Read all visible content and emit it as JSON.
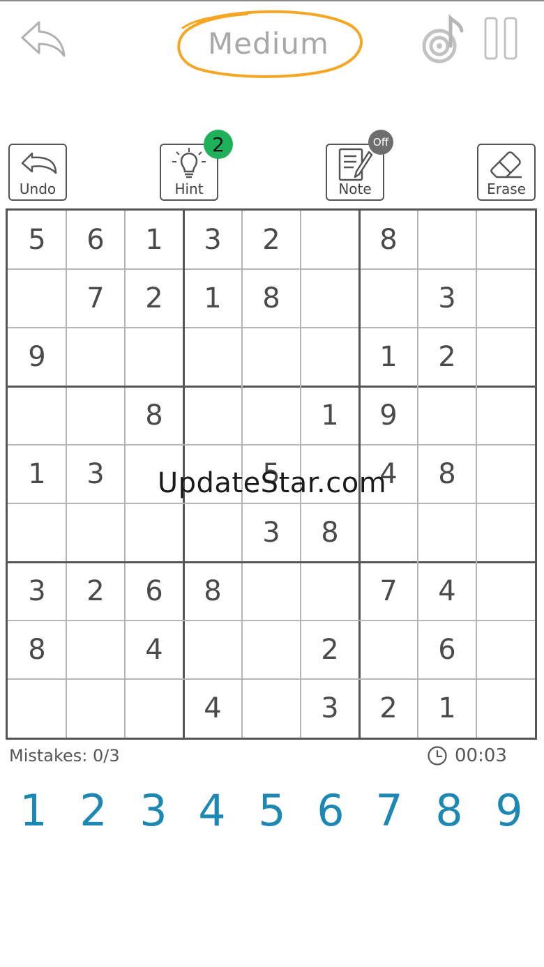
{
  "header": {
    "difficulty": "Medium",
    "accent_color": "#f5a623"
  },
  "tools": {
    "undo_label": "Undo",
    "hint_label": "Hint",
    "hint_count": "2",
    "note_label": "Note",
    "note_state": "Off",
    "erase_label": "Erase"
  },
  "board": {
    "rows": [
      [
        "5",
        "6",
        "1",
        "3",
        "2",
        "",
        "8",
        "",
        ""
      ],
      [
        "",
        "7",
        "2",
        "1",
        "8",
        "",
        "",
        "3",
        ""
      ],
      [
        "9",
        "",
        "",
        "",
        "",
        "",
        "1",
        "2",
        ""
      ],
      [
        "",
        "",
        "8",
        "",
        "",
        "1",
        "9",
        "",
        ""
      ],
      [
        "1",
        "3",
        "",
        "",
        "5",
        "",
        "4",
        "8",
        ""
      ],
      [
        "",
        "",
        "",
        "",
        "3",
        "8",
        "",
        "",
        ""
      ],
      [
        "3",
        "2",
        "6",
        "8",
        "",
        "",
        "7",
        "4",
        ""
      ],
      [
        "8",
        "",
        "4",
        "",
        "",
        "2",
        "",
        "6",
        ""
      ],
      [
        "",
        "",
        "",
        "4",
        "",
        "3",
        "2",
        "1",
        ""
      ]
    ]
  },
  "watermark": "UpdateStar.com",
  "status": {
    "mistakes": "Mistakes: 0/3",
    "timer": "00:03"
  },
  "numpad": [
    "1",
    "2",
    "3",
    "4",
    "5",
    "6",
    "7",
    "8",
    "9"
  ],
  "icons": {
    "back": "back-arrow-icon",
    "music": "music-note-icon",
    "pause": "pause-icon",
    "undo": "undo-icon",
    "hint": "lightbulb-icon",
    "note": "pencil-note-icon",
    "erase": "eraser-icon",
    "clock": "clock-icon"
  },
  "colors": {
    "numpad": "#1e88b4",
    "hint_badge": "#1fb05a",
    "note_badge": "#6e6e6e"
  }
}
